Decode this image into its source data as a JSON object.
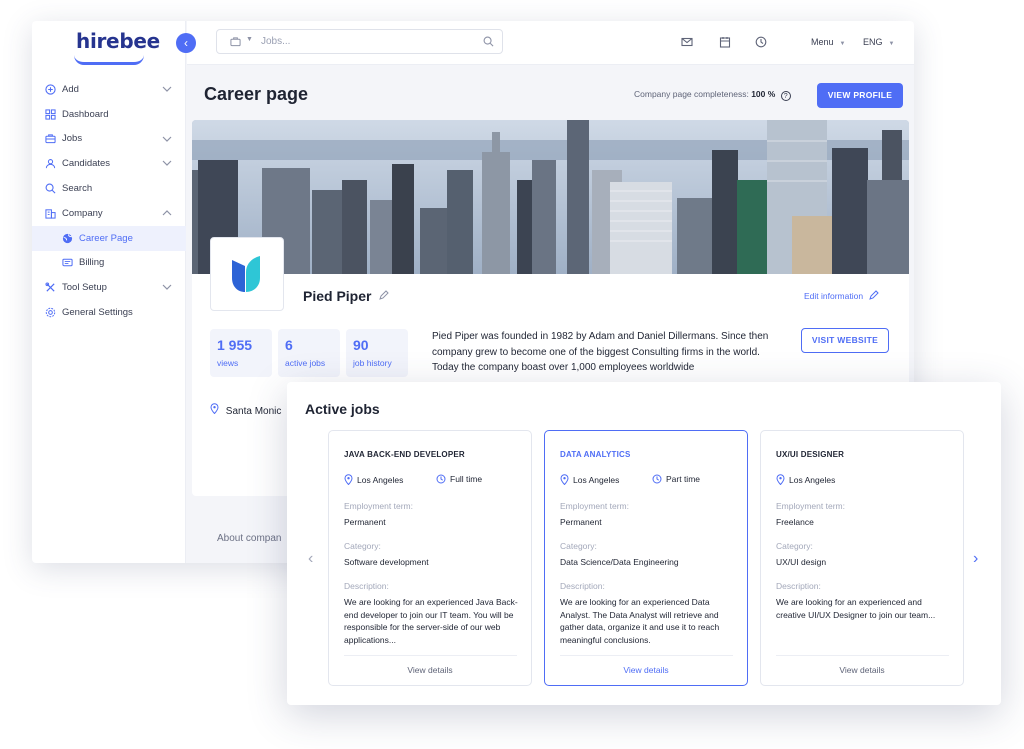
{
  "app": {
    "logo": "hirebee",
    "collapse_icon": "chevron-left-icon"
  },
  "sidebar": {
    "items": [
      {
        "label": "Add",
        "icon": "plus-circle-icon",
        "has_chevron": true
      },
      {
        "label": "Dashboard",
        "icon": "grid-icon",
        "has_chevron": false
      },
      {
        "label": "Jobs",
        "icon": "briefcase-icon",
        "has_chevron": true
      },
      {
        "label": "Candidates",
        "icon": "user-icon",
        "has_chevron": true
      },
      {
        "label": "Search",
        "icon": "search-icon",
        "has_chevron": false
      },
      {
        "label": "Company",
        "icon": "building-icon",
        "has_chevron": true,
        "expanded": true
      },
      {
        "label": "Career Page",
        "icon": "globe-icon",
        "sub": true,
        "active": true
      },
      {
        "label": "Billing",
        "icon": "card-icon",
        "sub": true
      },
      {
        "label": "Tool Setup",
        "icon": "tools-icon",
        "has_chevron": true
      },
      {
        "label": "General Settings",
        "icon": "gear-icon",
        "has_chevron": false
      }
    ]
  },
  "topbar": {
    "search_placeholder": "Jobs...",
    "menu_label": "Menu",
    "language": "ENG"
  },
  "header": {
    "title": "Career page",
    "completeness_label": "Company page completeness:",
    "completeness_value": "100 %",
    "view_profile": "VIEW PROFILE"
  },
  "company": {
    "name": "Pied Piper",
    "edit_information": "Edit information",
    "stats": [
      {
        "value": "1 955",
        "label": "views"
      },
      {
        "value": "6",
        "label": "active jobs"
      },
      {
        "value": "90",
        "label": "job history"
      }
    ],
    "description": "Pied Piper was founded in 1982 by Adam and Daniel Dillermans. Since then company grew to become one of the biggest Consulting firms in the world. Today the company boast over 1,000 employees worldwide",
    "visit_website": "VISIT WEBSITE",
    "location": "Santa Monic",
    "about_tab": "About compan",
    "brand_color": "#4f6df5"
  },
  "jobs": {
    "title": "Active jobs",
    "cards": [
      {
        "title": "JAVA BACK-END DEVELOPER",
        "location": "Los Angeles",
        "type": "Full time",
        "term_label": "Employment term:",
        "term": "Permanent",
        "category_label": "Category:",
        "category": "Software development",
        "description_label": "Description:",
        "description": "We are looking for an experienced Java Back-end developer to join our IT team. You will be responsible for the server-side of our web applications...",
        "view_details": "View details"
      },
      {
        "title": "DATA ANALYTICS",
        "location": "Los Angeles",
        "type": "Part time",
        "term_label": "Employment term:",
        "term": "Permanent",
        "category_label": "Category:",
        "category": "Data Science/Data Engineering",
        "description_label": "Description:",
        "description": "We are looking for an experienced Data Analyst. The Data Analyst will retrieve and gather data, organize it and use it to reach meaningful conclusions.",
        "view_details": "View details",
        "selected": true
      },
      {
        "title": "UX/UI DESIGNER",
        "location": "Los Angeles",
        "type": "",
        "term_label": "Employment term:",
        "term": "Freelance",
        "category_label": "Category:",
        "category": "UX/UI design",
        "description_label": "Description:",
        "description": "We are looking for an experienced and creative UI/UX Designer to join our team...",
        "view_details": "View details"
      }
    ]
  }
}
